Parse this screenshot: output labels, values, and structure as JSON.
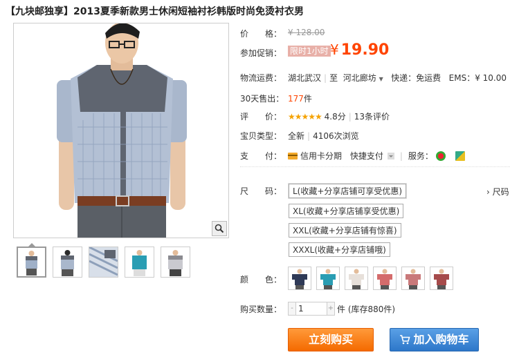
{
  "product": {
    "title": "【九块邮独享】2013夏季新款男士休闲短袖衬衫韩版时尚免烫衬衣男"
  },
  "price": {
    "label": "价　　格：",
    "original": "¥ 128.00"
  },
  "promo": {
    "label": "参加促销：",
    "tag": "限时1小时",
    "currency": "¥",
    "price": "19.90"
  },
  "shipping": {
    "label": "物流运费：",
    "from": "湖北武汉",
    "to_prefix": "至",
    "to": "河北廊坊",
    "express": "快递：免运费",
    "ems": "EMS：¥ 10.00"
  },
  "sales": {
    "label": "30天售出：",
    "count": "177",
    "unit": "件"
  },
  "rating": {
    "label": "评　　价：",
    "stars": "★★★★★",
    "score": "4.8分",
    "reviews": "13条评价"
  },
  "item_type": {
    "label": "宝贝类型：",
    "condition": "全新",
    "views": "4106次浏览"
  },
  "payment": {
    "label": "支　　付：",
    "credit": "信用卡分期",
    "quick": "快捷支付",
    "service": "服务："
  },
  "sizes": {
    "label": "尺　　码：",
    "options": [
      "L(收藏+分享店铺可享受优惠)",
      "XL(收藏+分享店铺享受优惠)",
      "XXL(收藏+分享店铺有惊喜)",
      "XXXL(收藏+分享店铺哦)"
    ],
    "guide": "› 尺码"
  },
  "colors": {
    "label": "颜　　色：",
    "swatches": [
      "#2f3a57",
      "#2a9db3",
      "#e7e0da",
      "#d46b6b",
      "#c9797a",
      "#a64b4b"
    ]
  },
  "quantity": {
    "label": "购买数量：",
    "value": "1",
    "minus": "-",
    "plus": "+",
    "stock": "件 (库存880件)"
  },
  "actions": {
    "buy": "立刻购买",
    "cart": "加入购物车"
  },
  "theme": {
    "accent": "#ff4400",
    "buy_color": "#f46a00",
    "cart_color": "#2d77c9"
  }
}
